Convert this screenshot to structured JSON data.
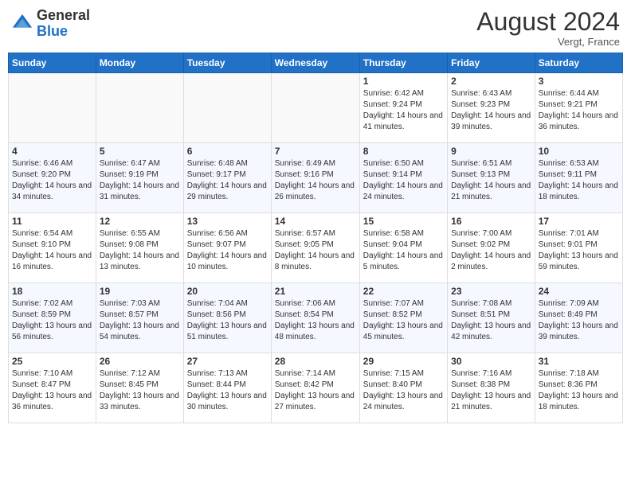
{
  "header": {
    "logo": {
      "line1": "General",
      "line2": "Blue"
    },
    "title": "August 2024",
    "location": "Vergt, France"
  },
  "days_of_week": [
    "Sunday",
    "Monday",
    "Tuesday",
    "Wednesday",
    "Thursday",
    "Friday",
    "Saturday"
  ],
  "weeks": [
    [
      {
        "day": "",
        "empty": true
      },
      {
        "day": "",
        "empty": true
      },
      {
        "day": "",
        "empty": true
      },
      {
        "day": "",
        "empty": true
      },
      {
        "day": "1",
        "sunrise": "6:42 AM",
        "sunset": "9:24 PM",
        "daylight": "14 hours and 41 minutes."
      },
      {
        "day": "2",
        "sunrise": "6:43 AM",
        "sunset": "9:23 PM",
        "daylight": "14 hours and 39 minutes."
      },
      {
        "day": "3",
        "sunrise": "6:44 AM",
        "sunset": "9:21 PM",
        "daylight": "14 hours and 36 minutes."
      }
    ],
    [
      {
        "day": "4",
        "sunrise": "6:46 AM",
        "sunset": "9:20 PM",
        "daylight": "14 hours and 34 minutes."
      },
      {
        "day": "5",
        "sunrise": "6:47 AM",
        "sunset": "9:19 PM",
        "daylight": "14 hours and 31 minutes."
      },
      {
        "day": "6",
        "sunrise": "6:48 AM",
        "sunset": "9:17 PM",
        "daylight": "14 hours and 29 minutes."
      },
      {
        "day": "7",
        "sunrise": "6:49 AM",
        "sunset": "9:16 PM",
        "daylight": "14 hours and 26 minutes."
      },
      {
        "day": "8",
        "sunrise": "6:50 AM",
        "sunset": "9:14 PM",
        "daylight": "14 hours and 24 minutes."
      },
      {
        "day": "9",
        "sunrise": "6:51 AM",
        "sunset": "9:13 PM",
        "daylight": "14 hours and 21 minutes."
      },
      {
        "day": "10",
        "sunrise": "6:53 AM",
        "sunset": "9:11 PM",
        "daylight": "14 hours and 18 minutes."
      }
    ],
    [
      {
        "day": "11",
        "sunrise": "6:54 AM",
        "sunset": "9:10 PM",
        "daylight": "14 hours and 16 minutes."
      },
      {
        "day": "12",
        "sunrise": "6:55 AM",
        "sunset": "9:08 PM",
        "daylight": "14 hours and 13 minutes."
      },
      {
        "day": "13",
        "sunrise": "6:56 AM",
        "sunset": "9:07 PM",
        "daylight": "14 hours and 10 minutes."
      },
      {
        "day": "14",
        "sunrise": "6:57 AM",
        "sunset": "9:05 PM",
        "daylight": "14 hours and 8 minutes."
      },
      {
        "day": "15",
        "sunrise": "6:58 AM",
        "sunset": "9:04 PM",
        "daylight": "14 hours and 5 minutes."
      },
      {
        "day": "16",
        "sunrise": "7:00 AM",
        "sunset": "9:02 PM",
        "daylight": "14 hours and 2 minutes."
      },
      {
        "day": "17",
        "sunrise": "7:01 AM",
        "sunset": "9:01 PM",
        "daylight": "13 hours and 59 minutes."
      }
    ],
    [
      {
        "day": "18",
        "sunrise": "7:02 AM",
        "sunset": "8:59 PM",
        "daylight": "13 hours and 56 minutes."
      },
      {
        "day": "19",
        "sunrise": "7:03 AM",
        "sunset": "8:57 PM",
        "daylight": "13 hours and 54 minutes."
      },
      {
        "day": "20",
        "sunrise": "7:04 AM",
        "sunset": "8:56 PM",
        "daylight": "13 hours and 51 minutes."
      },
      {
        "day": "21",
        "sunrise": "7:06 AM",
        "sunset": "8:54 PM",
        "daylight": "13 hours and 48 minutes."
      },
      {
        "day": "22",
        "sunrise": "7:07 AM",
        "sunset": "8:52 PM",
        "daylight": "13 hours and 45 minutes."
      },
      {
        "day": "23",
        "sunrise": "7:08 AM",
        "sunset": "8:51 PM",
        "daylight": "13 hours and 42 minutes."
      },
      {
        "day": "24",
        "sunrise": "7:09 AM",
        "sunset": "8:49 PM",
        "daylight": "13 hours and 39 minutes."
      }
    ],
    [
      {
        "day": "25",
        "sunrise": "7:10 AM",
        "sunset": "8:47 PM",
        "daylight": "13 hours and 36 minutes."
      },
      {
        "day": "26",
        "sunrise": "7:12 AM",
        "sunset": "8:45 PM",
        "daylight": "13 hours and 33 minutes."
      },
      {
        "day": "27",
        "sunrise": "7:13 AM",
        "sunset": "8:44 PM",
        "daylight": "13 hours and 30 minutes."
      },
      {
        "day": "28",
        "sunrise": "7:14 AM",
        "sunset": "8:42 PM",
        "daylight": "13 hours and 27 minutes."
      },
      {
        "day": "29",
        "sunrise": "7:15 AM",
        "sunset": "8:40 PM",
        "daylight": "13 hours and 24 minutes."
      },
      {
        "day": "30",
        "sunrise": "7:16 AM",
        "sunset": "8:38 PM",
        "daylight": "13 hours and 21 minutes."
      },
      {
        "day": "31",
        "sunrise": "7:18 AM",
        "sunset": "8:36 PM",
        "daylight": "13 hours and 18 minutes."
      }
    ]
  ],
  "labels": {
    "sunrise_prefix": "Sunrise:",
    "sunset_prefix": "Sunset:",
    "daylight_prefix": "Daylight:"
  }
}
